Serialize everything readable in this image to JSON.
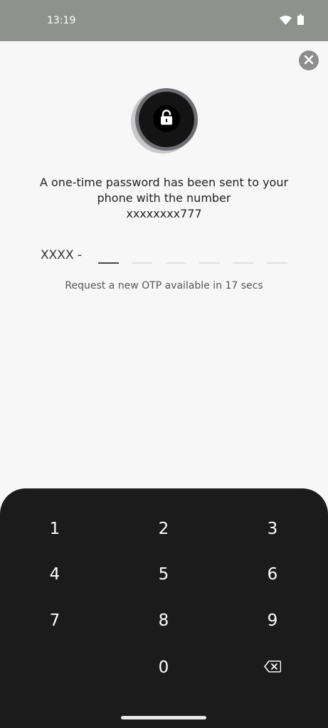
{
  "status_bar": {
    "time": "13:19",
    "icons": [
      "wifi-icon",
      "battery-icon"
    ]
  },
  "header": {
    "close_icon": "close-icon"
  },
  "lock_badge": {
    "icon": "lock-icon"
  },
  "message": {
    "line1": "A one-time password has been sent to your",
    "line2": "phone with the number",
    "phone": "xxxxxxxx777"
  },
  "otp": {
    "prefix": "XXXX -",
    "digit_count": 6,
    "active_index": 0
  },
  "resend": {
    "text": "Request a new OTP available in 17 secs"
  },
  "keypad": {
    "keys": [
      "1",
      "2",
      "3",
      "4",
      "5",
      "6",
      "7",
      "8",
      "9",
      "0"
    ],
    "backspace_icon": "backspace-icon"
  },
  "colors": {
    "status_bar": "#8f918d",
    "background": "#f7f7f7",
    "keypad": "#1b1b1b"
  }
}
